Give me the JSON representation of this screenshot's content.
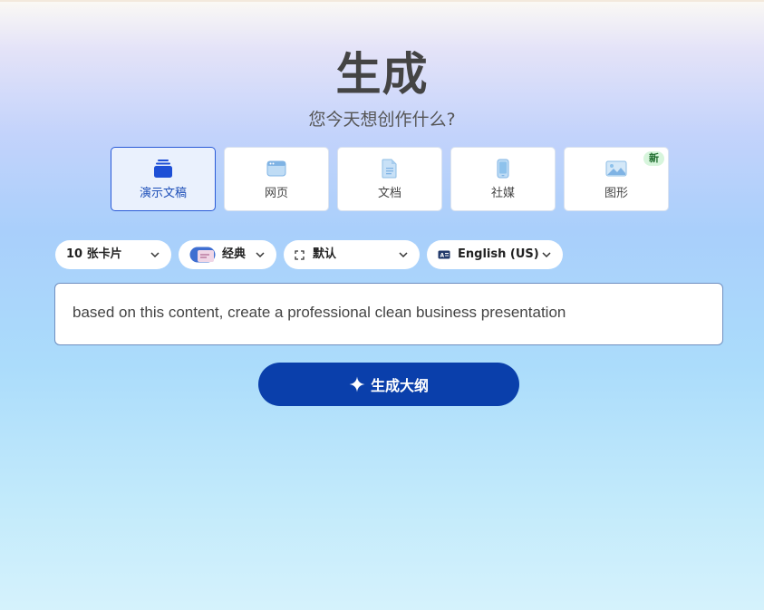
{
  "header": {
    "title": "生成",
    "subtitle": "您今天想创作什么?"
  },
  "types": [
    {
      "label": "演示文稿",
      "icon": "presentation-stack-icon",
      "active": true
    },
    {
      "label": "网页",
      "icon": "webpage-icon",
      "active": false
    },
    {
      "label": "文档",
      "icon": "document-icon",
      "active": false
    },
    {
      "label": "社媒",
      "icon": "mobile-phone-icon",
      "active": false
    },
    {
      "label": "图形",
      "icon": "image-icon",
      "active": false,
      "badge": "新"
    }
  ],
  "options": {
    "cards_count": "10 张卡片",
    "theme": "经典",
    "dimension": "默认",
    "language": "English (US)"
  },
  "prompt": {
    "value": "based on this content, create a professional clean business presentation"
  },
  "generate_button": {
    "label": "生成大纲"
  },
  "colors": {
    "accent": "#0a3fab",
    "active_card_border": "#2a5bd7",
    "new_badge_bg": "#d7f5dc"
  }
}
